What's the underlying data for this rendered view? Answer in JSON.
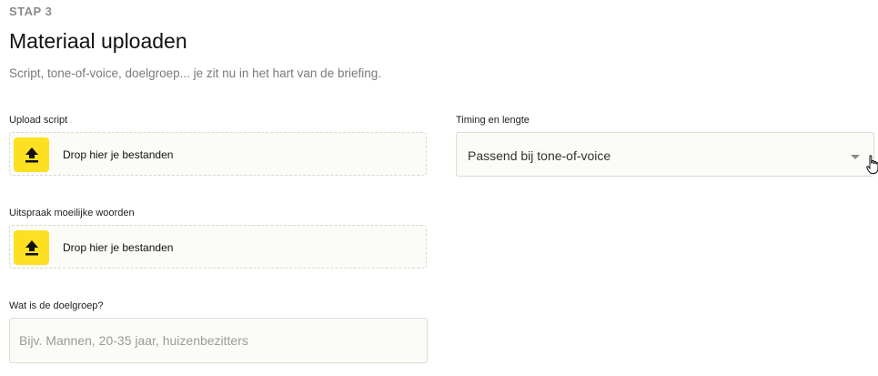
{
  "header": {
    "step": "STAP 3",
    "title": "Materiaal uploaden",
    "subtitle": "Script, tone-of-voice, doelgroep... je zit nu in het hart van de briefing."
  },
  "upload_script": {
    "label": "Upload script",
    "drop_text": "Drop hier je bestanden",
    "icon": "upload-icon"
  },
  "pronunciation": {
    "label": "Uitspraak moeilijke woorden",
    "drop_text": "Drop hier je bestanden",
    "icon": "upload-icon"
  },
  "target_group": {
    "label": "Wat is de doelgroep?",
    "placeholder": "Bijv. Mannen, 20-35 jaar, huizenbezitters",
    "value": ""
  },
  "timing": {
    "label": "Timing en lengte",
    "selected": "Passend bij tone-of-voice",
    "icon": "caret-down-icon"
  },
  "colors": {
    "accent": "#fde021",
    "muted_text": "#7a7a7a",
    "field_background": "#fbfbf8",
    "field_border": "#dcdcd6"
  }
}
